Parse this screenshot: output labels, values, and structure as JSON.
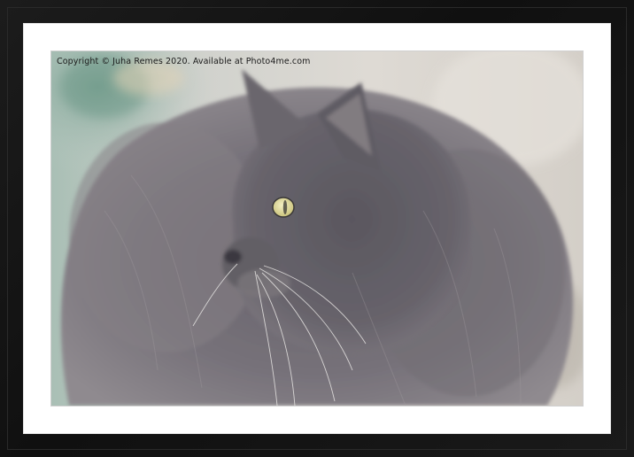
{
  "watermark": {
    "text": "Copyright  © Juha Remes  2020. Available at Photo4me.com"
  },
  "colors": {
    "frame": "#141414",
    "mount": "#ffffff",
    "fur_main": "#6f6b6e",
    "fur_light": "#9a9598",
    "eye": "#e8e2a2",
    "wall": "#d8d4cf",
    "foliage": "#8fb1a4"
  }
}
